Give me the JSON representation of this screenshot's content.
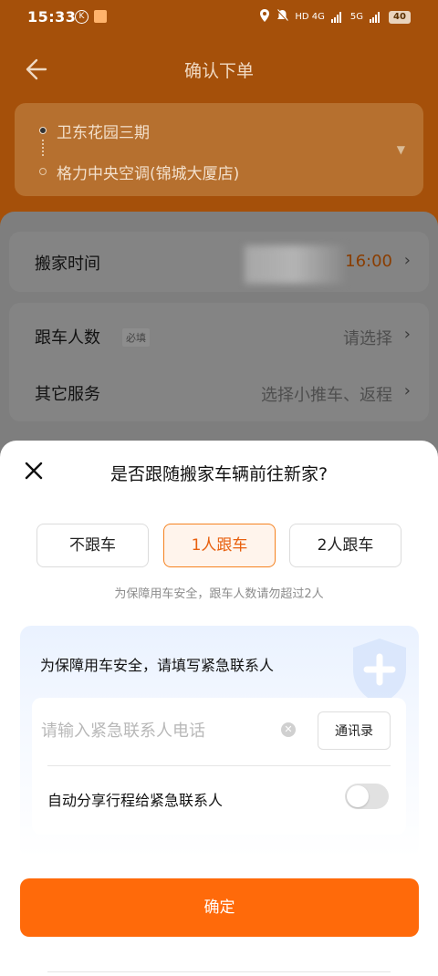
{
  "status_bar": {
    "time": "15:33",
    "network_1": "HD 4G",
    "network_2": "5G",
    "battery": "40"
  },
  "header": {
    "title": "确认下单"
  },
  "route": {
    "from": "卫东花园三期",
    "to": "格力中央空调(锦城大厦店)"
  },
  "form": {
    "move_time": {
      "label": "搬家时间",
      "value": "16:00"
    },
    "companions": {
      "label": "跟车人数",
      "required_tag": "必填",
      "value": "请选择"
    },
    "other_services": {
      "label": "其它服务",
      "value": "选择小推车、返程"
    }
  },
  "sheet": {
    "title": "是否跟随搬家车辆前往新家?",
    "options": [
      {
        "label": "不跟车",
        "selected": false
      },
      {
        "label": "1人跟车",
        "selected": true
      },
      {
        "label": "2人跟车",
        "selected": false
      }
    ],
    "hint": "为保障用车安全，跟车人数请勿超过2人",
    "contact": {
      "title": "为保障用车安全，请填写紧急联系人",
      "phone_placeholder": "请输入紧急联系人电话",
      "phone_value": "",
      "address_book": "通讯录",
      "share_label": "自动分享行程给紧急联系人",
      "share_enabled": false
    },
    "confirm_label": "确定"
  },
  "colors": {
    "accent": "#ff6a0a",
    "selected_border": "#f58220"
  }
}
